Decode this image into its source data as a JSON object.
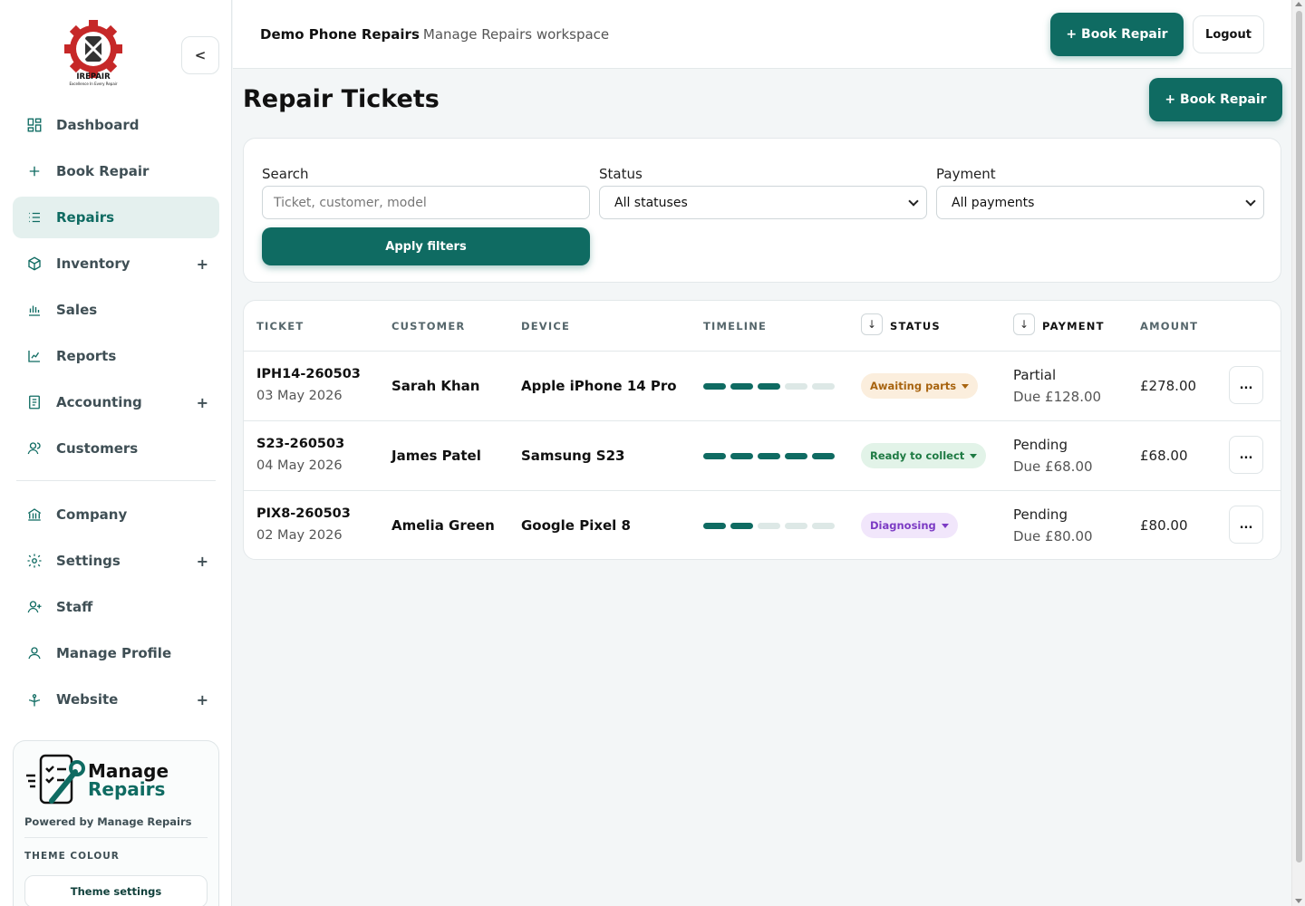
{
  "colors": {
    "accent": "#0f6b62",
    "accent_light": "#e4f0ee"
  },
  "sidebar": {
    "logo_text": "IREPAIR",
    "logo_tagline": "Excellence In Every Repair",
    "collapse_label": "<",
    "items": [
      {
        "label": "Dashboard",
        "icon": "dashboard-icon",
        "expandable": false,
        "active": false
      },
      {
        "label": "Book Repair",
        "icon": "plus-icon",
        "expandable": false,
        "active": false
      },
      {
        "label": "Repairs",
        "icon": "list-icon",
        "expandable": false,
        "active": true
      },
      {
        "label": "Inventory",
        "icon": "box-icon",
        "expandable": true,
        "active": false
      },
      {
        "label": "Sales",
        "icon": "bar-chart-icon",
        "expandable": false,
        "active": false
      },
      {
        "label": "Reports",
        "icon": "line-chart-icon",
        "expandable": false,
        "active": false
      },
      {
        "label": "Accounting",
        "icon": "ledger-icon",
        "expandable": true,
        "active": false
      },
      {
        "label": "Customers",
        "icon": "users-icon",
        "expandable": false,
        "active": false
      },
      {
        "label": "Company",
        "icon": "bank-icon",
        "expandable": false,
        "active": false
      },
      {
        "label": "Settings",
        "icon": "gear-icon",
        "expandable": true,
        "active": false
      },
      {
        "label": "Staff",
        "icon": "user-plus-icon",
        "expandable": false,
        "active": false
      },
      {
        "label": "Manage Profile",
        "icon": "user-icon",
        "expandable": false,
        "active": false
      },
      {
        "label": "Website",
        "icon": "website-icon",
        "expandable": true,
        "active": false
      }
    ],
    "expand_symbol": "+",
    "brand": {
      "word1": "Manage",
      "word2": "Repairs",
      "powered_by": "Powered by Manage Repairs",
      "theme_label": "THEME COLOUR",
      "theme_button": "Theme settings"
    }
  },
  "header": {
    "business_name": "Demo Phone Repairs",
    "workspace_label": "Manage Repairs workspace",
    "book_repair_label": "+ Book Repair",
    "logout_label": "Logout"
  },
  "main": {
    "title": "Repair Tickets",
    "book_repair_label": "+ Book Repair",
    "filters": {
      "search_label": "Search",
      "search_placeholder": "Ticket, customer, model",
      "status_label": "Status",
      "status_value": "All statuses",
      "payment_label": "Payment",
      "payment_value": "All payments",
      "apply_label": "Apply filters"
    },
    "table": {
      "columns": [
        "TICKET",
        "CUSTOMER",
        "DEVICE",
        "TIMELINE",
        "STATUS",
        "PAYMENT",
        "AMOUNT"
      ],
      "sort_symbol": "↓",
      "more_label": "...",
      "rows": [
        {
          "ticket": "IPH14-260503",
          "date": "03 May 2026",
          "customer": "Sarah Khan",
          "device": "Apple iPhone 14 Pro",
          "timeline_done": 3,
          "timeline_total": 5,
          "status": "Awaiting parts",
          "status_bg": "#fbeedd",
          "status_fg": "#a86410",
          "payment": "Partial",
          "due": "Due £128.00",
          "amount": "£278.00"
        },
        {
          "ticket": "S23-260503",
          "date": "04 May 2026",
          "customer": "James Patel",
          "device": "Samsung S23",
          "timeline_done": 5,
          "timeline_total": 5,
          "status": "Ready to collect",
          "status_bg": "#e2f3e8",
          "status_fg": "#1e7a43",
          "payment": "Pending",
          "due": "Due £68.00",
          "amount": "£68.00"
        },
        {
          "ticket": "PIX8-260503",
          "date": "02 May 2026",
          "customer": "Amelia Green",
          "device": "Google Pixel 8",
          "timeline_done": 2,
          "timeline_total": 5,
          "status": "Diagnosing",
          "status_bg": "#f1e6fb",
          "status_fg": "#7c3bc4",
          "payment": "Pending",
          "due": "Due £80.00",
          "amount": "£80.00"
        }
      ]
    }
  }
}
